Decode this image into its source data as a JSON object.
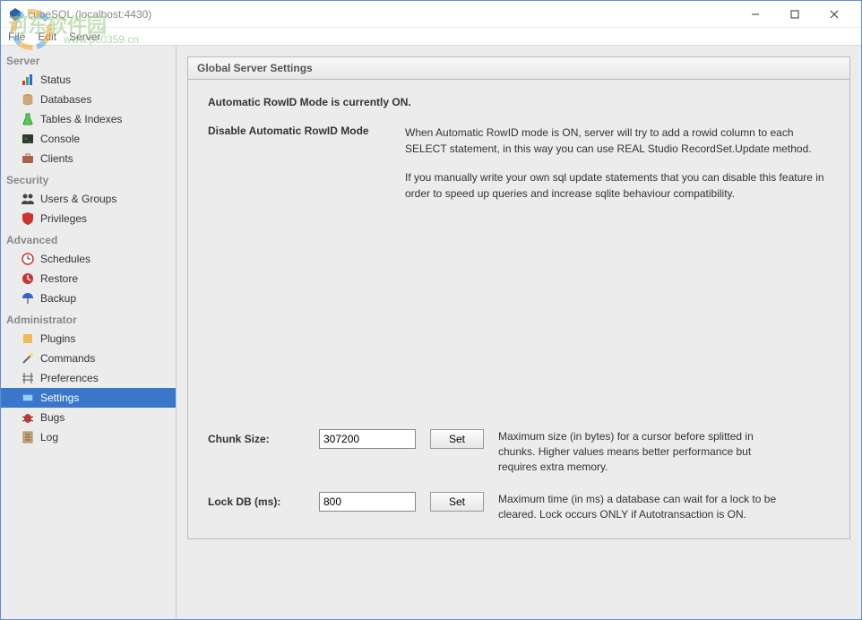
{
  "window": {
    "title": "cubeSQL (localhost:4430)"
  },
  "menubar": [
    "File",
    "Edit",
    "Server"
  ],
  "watermark": {
    "text": "河东软件园",
    "url": "www.pc0359.cn"
  },
  "sidebar": {
    "sections": [
      {
        "title": "Server",
        "items": [
          {
            "label": "Status",
            "icon": "bars"
          },
          {
            "label": "Databases",
            "icon": "database"
          },
          {
            "label": "Tables & Indexes",
            "icon": "flask"
          },
          {
            "label": "Console",
            "icon": "terminal"
          },
          {
            "label": "Clients",
            "icon": "briefcase"
          }
        ]
      },
      {
        "title": "Security",
        "items": [
          {
            "label": "Users & Groups",
            "icon": "users"
          },
          {
            "label": "Privileges",
            "icon": "shield"
          }
        ]
      },
      {
        "title": "Advanced",
        "items": [
          {
            "label": "Schedules",
            "icon": "clock"
          },
          {
            "label": "Restore",
            "icon": "restore"
          },
          {
            "label": "Backup",
            "icon": "umbrella"
          }
        ]
      },
      {
        "title": "Administrator",
        "items": [
          {
            "label": "Plugins",
            "icon": "plugin"
          },
          {
            "label": "Commands",
            "icon": "wand"
          },
          {
            "label": "Preferences",
            "icon": "pref"
          },
          {
            "label": "Settings",
            "icon": "settings",
            "selected": true
          },
          {
            "label": "Bugs",
            "icon": "bug"
          },
          {
            "label": "Log",
            "icon": "log"
          }
        ]
      }
    ]
  },
  "panel": {
    "title": "Global Server Settings",
    "status": "Automatic RowID Mode is currently ON.",
    "rowid": {
      "label": "Disable Automatic RowID Mode",
      "p1": "When Automatic RowID mode is ON, server will try to add a rowid column to each SELECT statement, in this way you can use REAL Studio RecordSet.Update method.",
      "p2": "If you manually write your own sql update statements that you can disable this feature in order to speed up queries and increase sqlite behaviour compatibility."
    },
    "chunk": {
      "label": "Chunk Size:",
      "value": "307200",
      "button": "Set",
      "desc": "Maximum size (in bytes) for a cursor before splitted in chunks. Higher values means better performance but requires extra memory."
    },
    "lock": {
      "label": "Lock DB (ms):",
      "value": "800",
      "button": "Set",
      "desc": "Maximum time (in ms) a database can wait for a lock to be cleared. Lock occurs ONLY if Autotransaction is ON."
    }
  }
}
